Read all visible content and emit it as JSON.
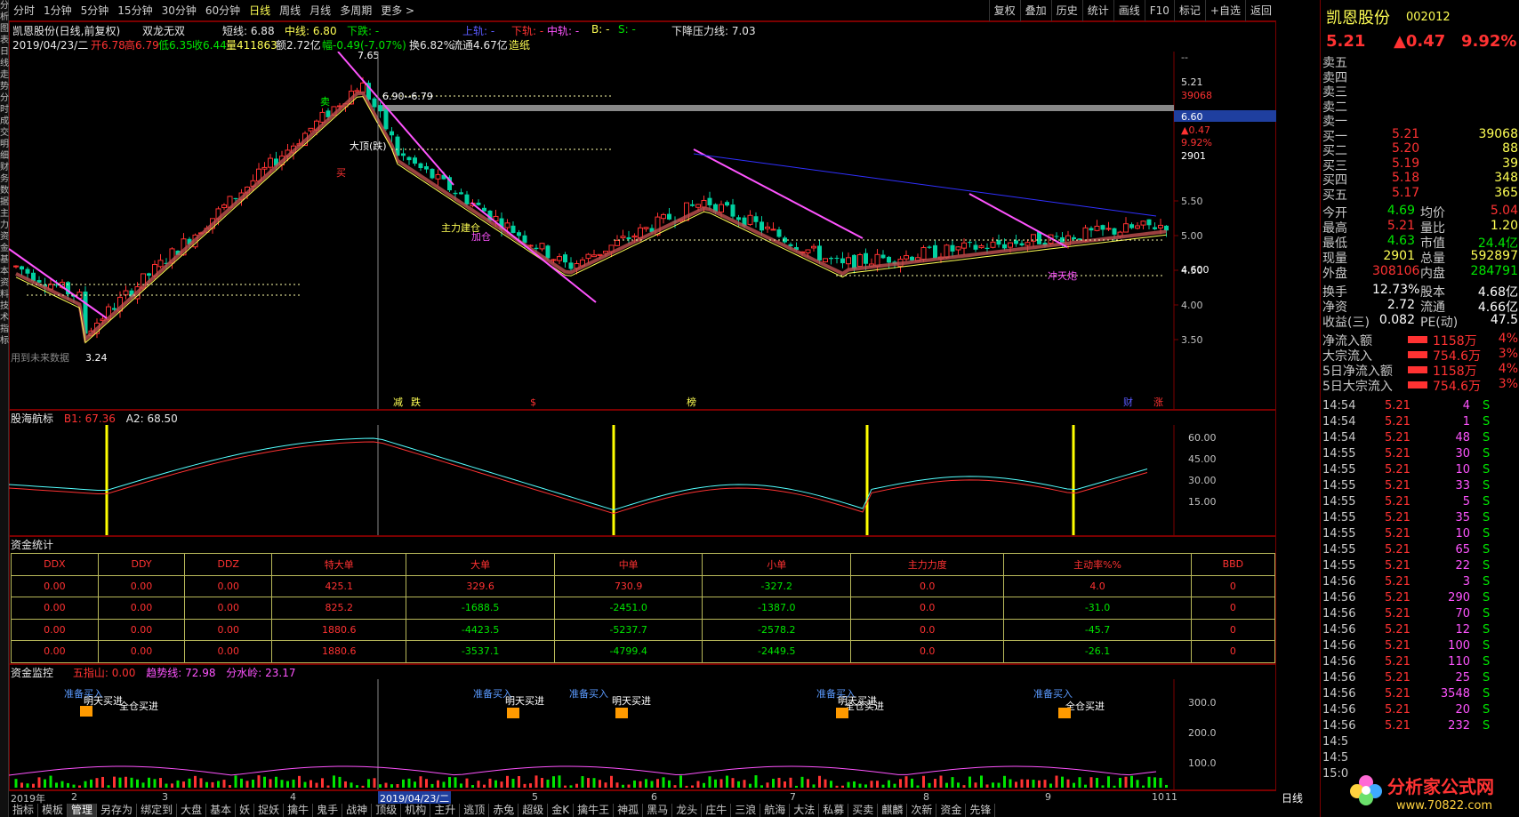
{
  "left_strip": [
    "分",
    "析",
    "图",
    "表",
    "日",
    "线",
    "走",
    "势",
    "分",
    "时",
    "成",
    "交",
    "明",
    "细",
    "财",
    "务",
    "数",
    "据",
    "主",
    "力",
    "资",
    "金",
    "基",
    "本",
    "资",
    "料",
    "技",
    "术",
    "指",
    "标"
  ],
  "toolbar": {
    "periods": [
      "分时",
      "1分钟",
      "5分钟",
      "15分钟",
      "30分钟",
      "60分钟",
      "日线",
      "周线",
      "月线",
      "多周期",
      "更多 >"
    ],
    "active_period": "日线",
    "right_buttons": [
      "复权",
      "叠加",
      "历史",
      "统计",
      "画线",
      "F10",
      "标记",
      "+自选",
      "返回"
    ]
  },
  "info_line1": {
    "title": "凯恩股份(日线,前复权)",
    "indicator": "双龙无双",
    "short_line": "短线: 6.88",
    "mid_line": "中线: 6.80",
    "down_trend": "下跌: -",
    "up_rail": "上轨: -",
    "down_rail": "下轨: -",
    "mid_rail": "中轨: -",
    "b": "B: -",
    "s": "S: -",
    "pressure": "下降压力线: 7.03"
  },
  "info_line2": {
    "date": "2019/04/23/二",
    "open": "开6.78",
    "high": "高6.79",
    "low": "低6.35",
    "close": "收6.44",
    "volume": "量411863",
    "amount": "额2.72亿",
    "change": "幅-0.49(-7.07%)",
    "turnover": "换6.82%",
    "float": "流通4.67亿",
    "tag": "造纸"
  },
  "main_chart": {
    "y_ticks": [
      "5.50",
      "5.00",
      "4.50",
      "4.00",
      "3.50"
    ],
    "right_price_tags": [
      "--",
      "5.21",
      "39068",
      "6.60",
      "▲0.47",
      "9.92%",
      "2901",
      "4.600"
    ],
    "annotations": [
      "7.65",
      "6.90--6.79",
      "大顶(跌)",
      "主力建仓",
      "3.24",
      "用到未来数据",
      "加仓",
      "冲天炮",
      "卖",
      "买"
    ],
    "bottom_marks": [
      "减",
      "跌",
      "$",
      "榜",
      "财",
      "涨"
    ]
  },
  "indicator1": {
    "title": "股海航标",
    "b1": "B1: 67.36",
    "a2": "A2: 68.50",
    "y_ticks": [
      "60.00",
      "45.00",
      "30.00",
      "15.00"
    ]
  },
  "fund_stats": {
    "title": "资金统计",
    "headers": [
      "DDX",
      "DDY",
      "DDZ",
      "特大单",
      "大单",
      "中单",
      "小单",
      "主力力度",
      "主动率%%",
      "BBD"
    ],
    "rows": [
      [
        "0.00",
        "0.00",
        "0.00",
        "425.1",
        "329.6",
        "730.9",
        "-327.2",
        "0.0",
        "4.0",
        "0"
      ],
      [
        "0.00",
        "0.00",
        "0.00",
        "825.2",
        "-1688.5",
        "-2451.0",
        "-1387.0",
        "0.0",
        "-31.0",
        "0"
      ],
      [
        "0.00",
        "0.00",
        "0.00",
        "1880.6",
        "-4423.5",
        "-5237.7",
        "-2578.2",
        "0.0",
        "-45.7",
        "0"
      ],
      [
        "0.00",
        "0.00",
        "0.00",
        "1880.6",
        "-3537.1",
        "-4799.4",
        "-2449.5",
        "0.0",
        "-26.1",
        "0"
      ]
    ]
  },
  "fund_monitor": {
    "title": "资金监控",
    "wuzhishan": "五指山: 0.00",
    "trend": "趋势线: 72.98",
    "watershed": "分水岭: 23.17",
    "y_ticks": [
      "300.0",
      "200.0",
      "100.0"
    ],
    "labels": [
      "准备买入",
      "明天买进",
      "全仓买进",
      "准备买入",
      "明天买进",
      "准备买入",
      "明天买进",
      "准备买入",
      "明天买进",
      "全仓买进",
      "准备买入",
      "全仓买进"
    ]
  },
  "date_axis": [
    "2019年",
    "2",
    "3",
    "4",
    "2019/04/23/二",
    "5",
    "6",
    "7",
    "8",
    "9",
    "10",
    "11"
  ],
  "bottom_tabs": [
    "指标",
    "模板",
    "管理",
    "另存为",
    "绑定到",
    "大盘",
    "基本",
    "妖",
    "捉妖",
    "擒牛",
    "鬼手",
    "战神",
    "顶级",
    "机构",
    "主升",
    "逃顶",
    "赤兔",
    "超级",
    "金K",
    "擒牛王",
    "神孤",
    "黑马",
    "龙头",
    "庄牛",
    "三浪",
    "航海",
    "大法",
    "私募",
    "买卖",
    "麒麟",
    "次新",
    "资金",
    "先锋"
  ],
  "bottom_tab_active": "管理",
  "right_panel": {
    "stock_name": "凯恩股份",
    "code": "002012",
    "price": "5.21",
    "change": "▲0.47",
    "pct": "9.92%",
    "sell": [
      [
        "卖五",
        "",
        ""
      ],
      [
        "卖四",
        "",
        ""
      ],
      [
        "卖三",
        "",
        ""
      ],
      [
        "卖二",
        "",
        ""
      ],
      [
        "卖一",
        "",
        ""
      ]
    ],
    "buy": [
      [
        "买一",
        "5.21",
        "39068"
      ],
      [
        "买二",
        "5.20",
        "88"
      ],
      [
        "买三",
        "5.19",
        "39"
      ],
      [
        "买四",
        "5.18",
        "348"
      ],
      [
        "买五",
        "5.17",
        "365"
      ]
    ],
    "stats": [
      [
        "今开",
        "4.69",
        "均价",
        "5.04"
      ],
      [
        "最高",
        "5.21",
        "量比",
        "1.20"
      ],
      [
        "最低",
        "4.63",
        "市值",
        "24.4亿"
      ],
      [
        "现量",
        "2901",
        "总量",
        "592897"
      ],
      [
        "外盘",
        "308106",
        "内盘",
        "284791"
      ]
    ],
    "stats2": [
      [
        "换手",
        "12.73%",
        "股本",
        "4.68亿"
      ],
      [
        "净资",
        "2.72",
        "流通",
        "4.66亿"
      ],
      [
        "收益(三)",
        "0.082",
        "PE(动)",
        "47.5"
      ]
    ],
    "flows": [
      [
        "净流入额",
        "1158万",
        "4%"
      ],
      [
        "大宗流入",
        "754.6万",
        "3%"
      ],
      [
        "5日净流入额",
        "1158万",
        "4%"
      ],
      [
        "5日大宗流入",
        "754.6万",
        "3%"
      ]
    ],
    "ticks": [
      [
        "14:54",
        "5.21",
        "4",
        "S"
      ],
      [
        "14:54",
        "5.21",
        "1",
        "S"
      ],
      [
        "14:54",
        "5.21",
        "48",
        "S"
      ],
      [
        "14:55",
        "5.21",
        "30",
        "S"
      ],
      [
        "14:55",
        "5.21",
        "10",
        "S"
      ],
      [
        "14:55",
        "5.21",
        "33",
        "S"
      ],
      [
        "14:55",
        "5.21",
        "5",
        "S"
      ],
      [
        "14:55",
        "5.21",
        "35",
        "S"
      ],
      [
        "14:55",
        "5.21",
        "10",
        "S"
      ],
      [
        "14:55",
        "5.21",
        "65",
        "S"
      ],
      [
        "14:55",
        "5.21",
        "22",
        "S"
      ],
      [
        "14:56",
        "5.21",
        "3",
        "S"
      ],
      [
        "14:56",
        "5.21",
        "290",
        "S"
      ],
      [
        "14:56",
        "5.21",
        "70",
        "S"
      ],
      [
        "14:56",
        "5.21",
        "12",
        "S"
      ],
      [
        "14:56",
        "5.21",
        "100",
        "S"
      ],
      [
        "14:56",
        "5.21",
        "110",
        "S"
      ],
      [
        "14:56",
        "5.21",
        "25",
        "S"
      ],
      [
        "14:56",
        "5.21",
        "3548",
        "S"
      ],
      [
        "14:56",
        "5.21",
        "20",
        "S"
      ],
      [
        "14:56",
        "5.21",
        "232",
        "S"
      ],
      [
        "14:5",
        "",
        "",
        ""
      ],
      [
        "14:5",
        "",
        "",
        ""
      ],
      [
        "15:0",
        "",
        "",
        ""
      ]
    ],
    "period_label": "日线"
  },
  "watermark": {
    "text": "分析家公式网",
    "url": "www.70822.com"
  }
}
